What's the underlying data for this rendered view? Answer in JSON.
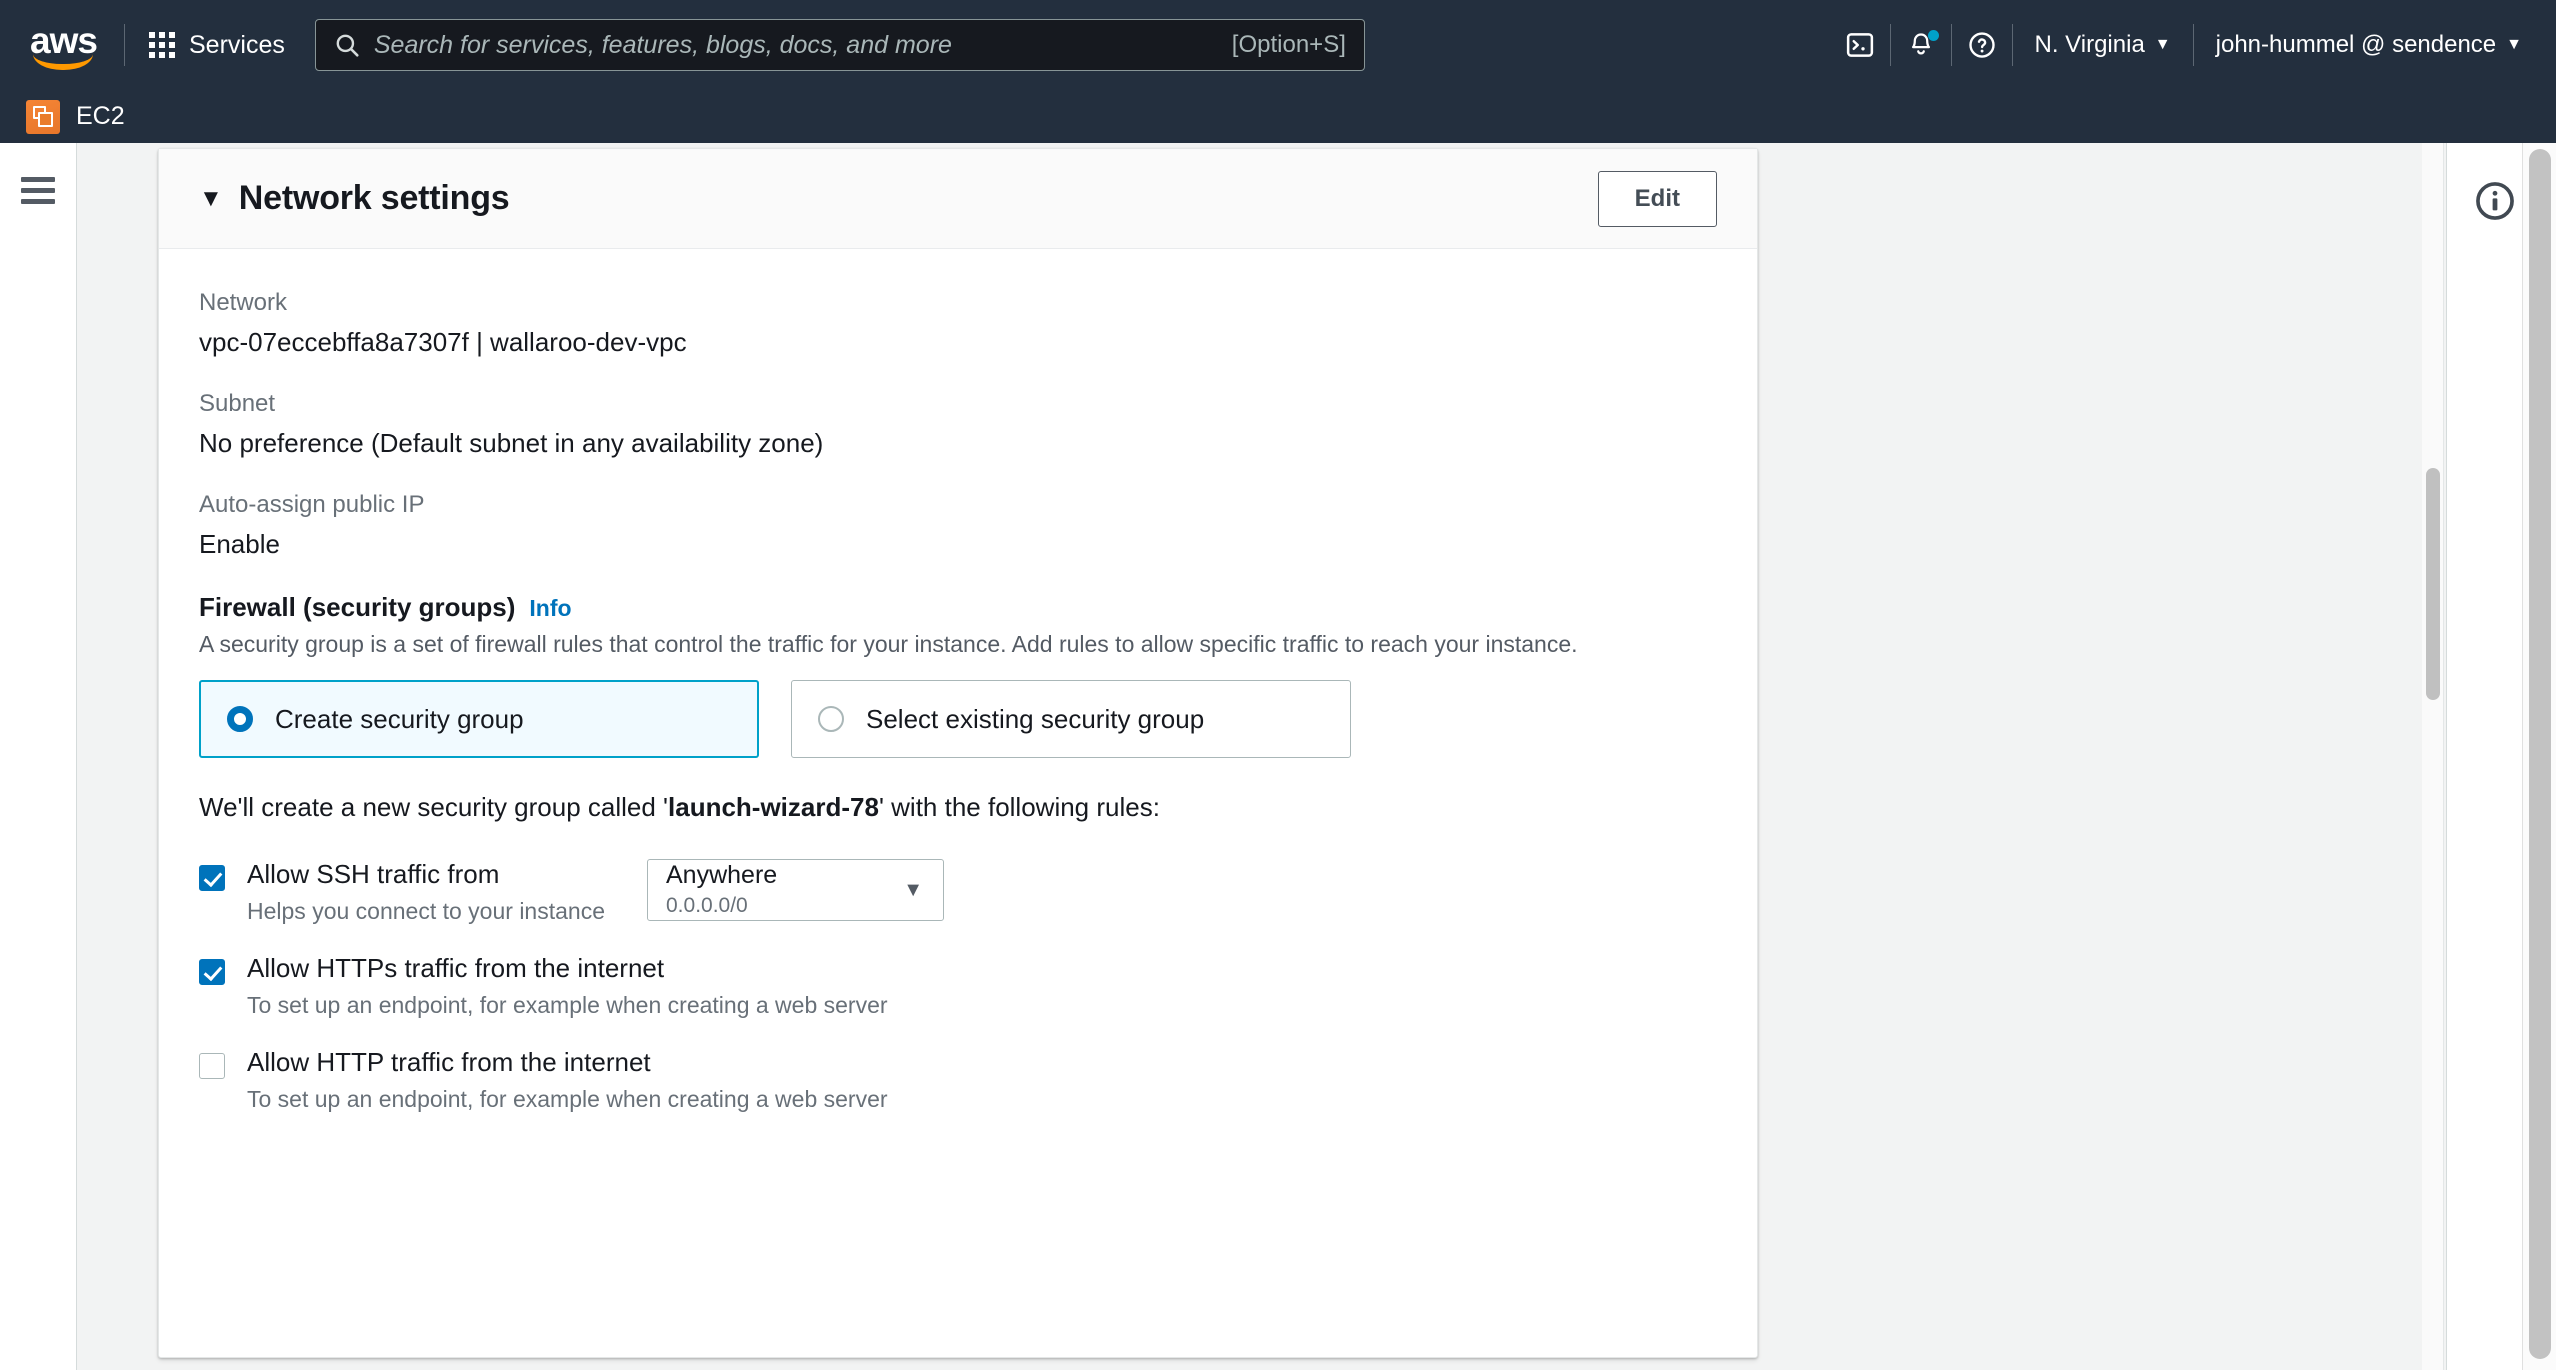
{
  "top_nav": {
    "logo_wordmark": "aws",
    "services_label": "Services",
    "grid_icon": "grid-icon",
    "search": {
      "icon": "search-icon",
      "placeholder": "Search for services, features, blogs, docs, and more",
      "value": "",
      "shortcut": "[Option+S]"
    },
    "cloudshell_icon": "cloudshell-icon",
    "notifications_icon": "bell-icon",
    "help_icon": "question-circle-icon",
    "region_label": "N. Virginia",
    "account_label": "john-hummel @ sendence",
    "caret": "▼",
    "notification_dot_color": "#00a1c9"
  },
  "service_bar": {
    "service_icon": "ec2-service-icon",
    "service_name": "EC2"
  },
  "left_rail": {
    "menu_icon": "hamburger-menu-icon"
  },
  "right_rail": {
    "info_icon": "info-circle-icon"
  },
  "card": {
    "collapse_caret": "▼",
    "title": "Network settings",
    "edit_label": "Edit",
    "fields": [
      {
        "label": "Network",
        "value": "vpc-07eccebffa8a7307f | wallaroo-dev-vpc"
      },
      {
        "label": "Subnet",
        "value": "No preference (Default subnet in any availability zone)"
      },
      {
        "label": "Auto-assign public IP",
        "value": "Enable"
      }
    ],
    "firewall": {
      "heading": "Firewall (security groups)",
      "info_label": "Info",
      "description": "A security group is a set of firewall rules that control the traffic for your instance. Add rules to allow specific traffic to reach your instance.",
      "options": [
        {
          "label": "Create security group",
          "selected": true
        },
        {
          "label": "Select existing security group",
          "selected": false
        }
      ],
      "note_prefix": "We'll create a new security group called '",
      "note_group_name": "launch-wizard-78",
      "note_suffix": "' with the following rules:",
      "rules": [
        {
          "title": "Allow SSH traffic from",
          "subtitle": "Helps you connect to your instance",
          "checked": true,
          "select": {
            "main": "Anywhere",
            "sub": "0.0.0.0/0",
            "caret": "▼"
          }
        },
        {
          "title": "Allow HTTPs traffic from the internet",
          "subtitle": "To set up an endpoint, for example when creating a web server",
          "checked": true
        },
        {
          "title": "Allow HTTP traffic from the internet",
          "subtitle": "To set up an endpoint, for example when creating a web server",
          "checked": false
        }
      ]
    }
  },
  "colors": {
    "nav_bg": "#232f3e",
    "accent_blue": "#0073bb",
    "selected_border": "#00a1c9",
    "selected_bg": "#f1faff",
    "page_bg": "#f2f3f3",
    "ec2_orange": "#f58536"
  }
}
